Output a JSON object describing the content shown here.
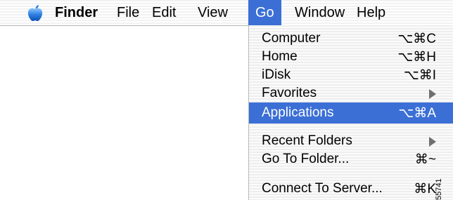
{
  "menubar": {
    "apple_icon": "apple-icon",
    "items": [
      "Finder",
      "File",
      "Edit",
      "View",
      "Go",
      "Window",
      "Help"
    ],
    "active": "Go"
  },
  "go_menu": {
    "items": [
      {
        "label": "Computer",
        "shortcut": "⌥⌘C"
      },
      {
        "label": "Home",
        "shortcut": "⌥⌘H"
      },
      {
        "label": "iDisk",
        "shortcut": "⌥⌘I"
      },
      {
        "label": "Favorites",
        "submenu": true
      },
      {
        "label": "Applications",
        "shortcut": "⌥⌘A",
        "selected": true
      },
      {
        "label": "Recent Folders",
        "submenu": true
      },
      {
        "label": "Go To Folder...",
        "shortcut": "⌘~"
      },
      {
        "label": "Connect To Server...",
        "shortcut": "⌘K"
      }
    ]
  },
  "side_code": "55741",
  "colors": {
    "highlight": "#3b6fd6",
    "menu_text": "#000000"
  }
}
